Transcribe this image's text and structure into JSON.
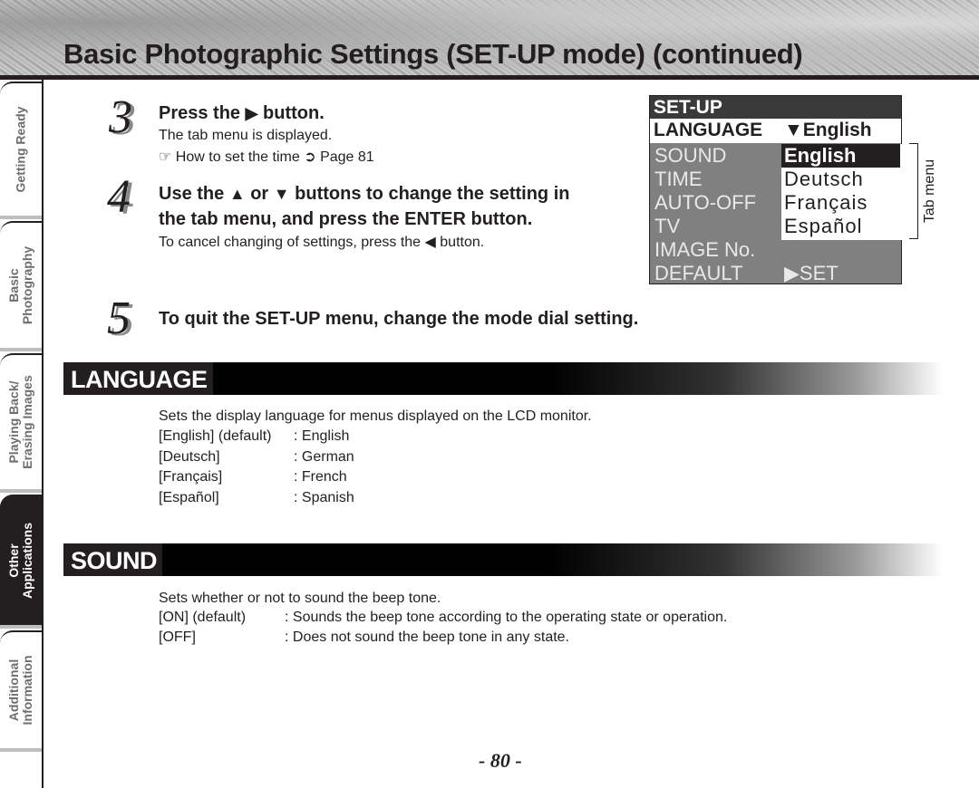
{
  "header": {
    "title": "Basic Photographic Settings (SET-UP mode) (continued)"
  },
  "sidebar": {
    "tabs": [
      {
        "line1": "Getting Ready",
        "line2": "",
        "active": false
      },
      {
        "line1": "Basic",
        "line2": "Photography",
        "active": false
      },
      {
        "line1": "Playing Back/",
        "line2": "Erasing Images",
        "active": false
      },
      {
        "line1": "Other",
        "line2": "Applications",
        "active": true
      },
      {
        "line1": "Additional",
        "line2": "Information",
        "active": false
      }
    ]
  },
  "steps": [
    {
      "number": "3",
      "heading_pre": "Press the",
      "heading_icon": "▶",
      "heading_post": "button.",
      "lines": [
        "The tab menu is displayed."
      ],
      "reference": {
        "icon": "☞",
        "text": "How to set the time",
        "arrow": "➲",
        "page": "Page 81"
      }
    },
    {
      "number": "4",
      "heading_line1_a": "Use the",
      "heading_up": "▲",
      "heading_line1_b": "or",
      "heading_down": "▼",
      "heading_line1_c": "buttons to change the setting in",
      "heading_line2": "the tab menu, and press the ENTER button.",
      "note_pre": "To cancel changing of settings, press the",
      "note_icon": "◀",
      "note_post": "button."
    },
    {
      "number": "5",
      "heading": "To quit the SET-UP menu, change the mode dial setting."
    }
  ],
  "lcd_menu": {
    "title": "SET-UP",
    "selected_item": "LANGUAGE",
    "selected_value": "▼English",
    "items": [
      "SOUND",
      "TIME",
      "AUTO-OFF",
      "TV",
      "IMAGE No.",
      "DEFAULT"
    ],
    "default_value": "▶SET",
    "dropdown_options": [
      "English",
      "Deutsch",
      "Français",
      "Español"
    ],
    "highlighted_option": "English",
    "tab_menu_label": "Tab menu"
  },
  "sections": {
    "language": {
      "title": "LANGUAGE",
      "description": "Sets the display language for menus displayed on the LCD monitor.",
      "options": [
        {
          "key": "[English] (default)",
          "value": ": English"
        },
        {
          "key": "[Deutsch]",
          "value": ": German"
        },
        {
          "key": "[Français]",
          "value": ": French"
        },
        {
          "key": "[Español]",
          "value": ": Spanish"
        }
      ]
    },
    "sound": {
      "title": "SOUND",
      "description": "Sets whether or not to sound the beep tone.",
      "options": [
        {
          "key": "[ON] (default)",
          "value": ": Sounds the beep tone according to the operating state or operation."
        },
        {
          "key": "[OFF]",
          "value": ": Does not sound the beep tone in any state."
        }
      ]
    }
  },
  "footer": {
    "page_number": "- 80 -"
  }
}
